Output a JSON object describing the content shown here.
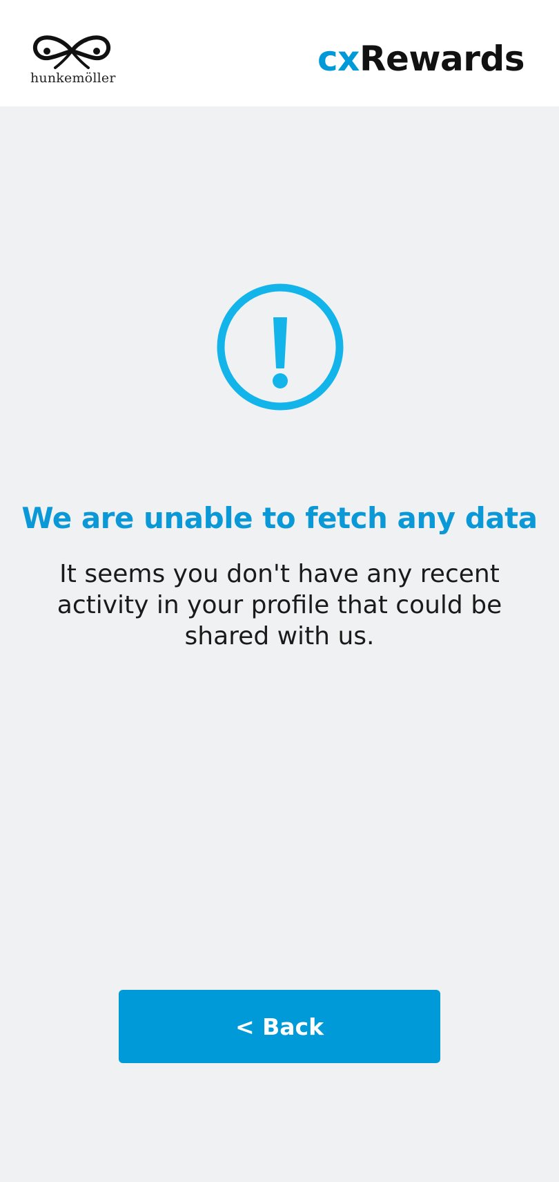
{
  "header": {
    "brand_name": "hunkemöller",
    "app_title_prefix": "cx",
    "app_title_suffix": "Rewards"
  },
  "main": {
    "icon": "exclamation-circle-icon",
    "title": "We are unable to fetch any data",
    "message": "It seems you don't have any recent activity in your profile that could be shared with us."
  },
  "actions": {
    "back_label": "< Back"
  },
  "colors": {
    "accent": "#009ad9",
    "icon": "#12b4ea",
    "background": "#f0f1f3",
    "header_background": "#ffffff",
    "text": "#1a1a1a"
  }
}
